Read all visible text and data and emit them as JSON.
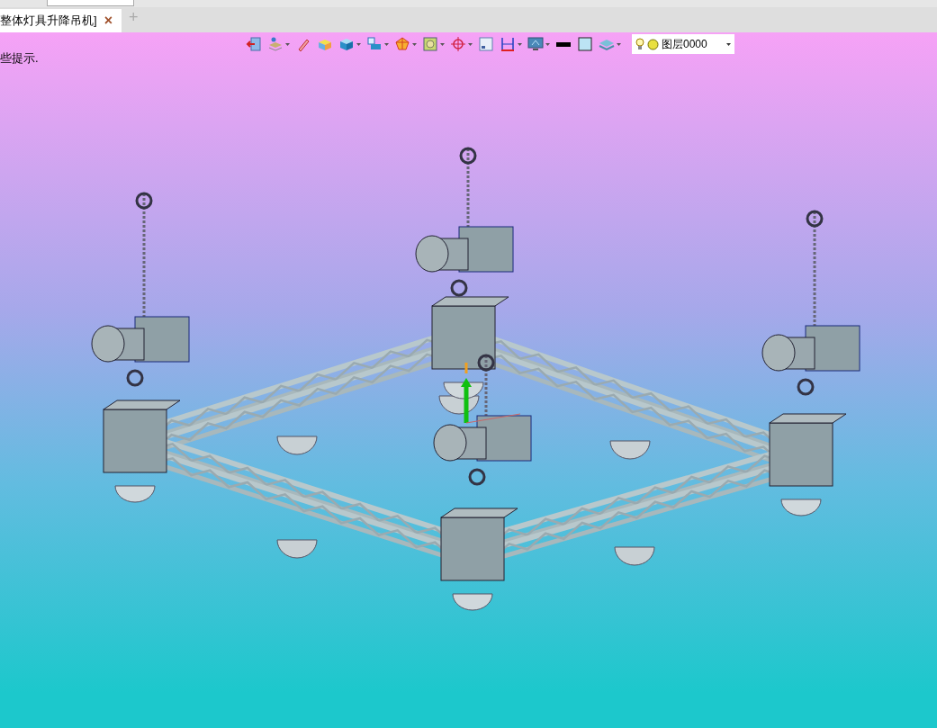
{
  "tabs": [
    {
      "title": "整体灯具升降吊机]",
      "close": "×",
      "selected": true
    }
  ],
  "new_tab": "+",
  "toolbar": [
    {
      "kind": "exit",
      "dropdown": false
    },
    {
      "kind": "layers",
      "dropdown": true
    },
    {
      "kind": "pencil",
      "dropdown": false
    },
    {
      "kind": "box",
      "dropdown": false
    },
    {
      "kind": "cube",
      "dropdown": true
    },
    {
      "kind": "cube2",
      "dropdown": true
    },
    {
      "kind": "polygon",
      "dropdown": true
    },
    {
      "kind": "frame",
      "dropdown": true
    },
    {
      "kind": "target",
      "dropdown": true
    },
    {
      "kind": "window",
      "dropdown": false
    },
    {
      "kind": "dimension",
      "dropdown": true
    },
    {
      "kind": "monitor",
      "dropdown": true
    },
    {
      "kind": "line",
      "dropdown": false
    },
    {
      "kind": "fill",
      "dropdown": false
    },
    {
      "kind": "stack",
      "dropdown": true
    }
  ],
  "layer": {
    "name": "图层0000"
  },
  "hint": "些提示."
}
